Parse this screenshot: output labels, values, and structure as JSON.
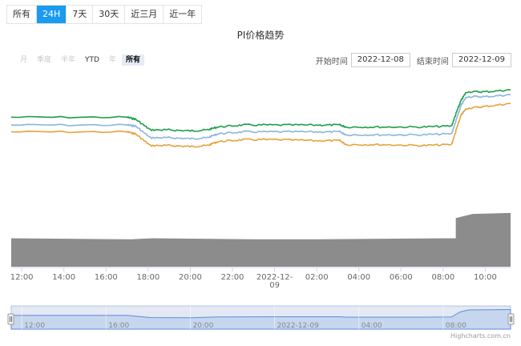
{
  "tabs": [
    {
      "label": "所有",
      "active": false
    },
    {
      "label": "24H",
      "active": true
    },
    {
      "label": "7天",
      "active": false
    },
    {
      "label": "30天",
      "active": false
    },
    {
      "label": "近三月",
      "active": false
    },
    {
      "label": "近一年",
      "active": false
    }
  ],
  "range_selector": {
    "buttons": [
      {
        "label": "月",
        "state": "disabled"
      },
      {
        "label": "季度",
        "state": "disabled"
      },
      {
        "label": "半年",
        "state": "disabled"
      },
      {
        "label": "YTD",
        "state": "enabled"
      },
      {
        "label": "年",
        "state": "disabled"
      },
      {
        "label": "所有",
        "state": "selected"
      }
    ],
    "start_label": "开始时间",
    "start_value": "2022-12-08",
    "end_label": "结束时间",
    "end_value": "2022-12-09"
  },
  "credit": "Highcharts.com.cn",
  "colors": {
    "green": "#1e9e4a",
    "blue": "#8ab6dd",
    "orange": "#e6a23c",
    "volume": "#8c8c8c",
    "navigator": "#ccd6eb"
  },
  "chart_data": {
    "type": "line",
    "title": "PI价格趋势",
    "x_tick_labels": [
      "12:00",
      "14:00",
      "16:00",
      "18:00",
      "20:00",
      "22:00",
      "2022-12-09",
      "02:00",
      "04:00",
      "06:00",
      "08:00",
      "10:00"
    ],
    "x_tick_hours": [
      12,
      14,
      16,
      18,
      20,
      22,
      24,
      26,
      28,
      30,
      32,
      34
    ],
    "x_range_hours": [
      11.5,
      35.2
    ],
    "y_range": [
      0,
      100
    ],
    "series": [
      {
        "color": "green",
        "x": [
          11.5,
          17.0,
          17.4,
          18.1,
          19.0,
          20.0,
          20.8,
          21.3,
          22.5,
          24.0,
          26.0,
          27.1,
          27.4,
          29.0,
          31.0,
          32.4,
          32.65,
          32.85,
          33.1,
          34.0,
          35.2
        ],
        "y": [
          62,
          62,
          60,
          49,
          49,
          48,
          49,
          52,
          54,
          54,
          54,
          54,
          52,
          52,
          52,
          53,
          68,
          79,
          88,
          88,
          90
        ]
      },
      {
        "color": "blue",
        "x": [
          11.5,
          17.0,
          17.4,
          18.1,
          19.0,
          20.0,
          20.8,
          21.3,
          22.5,
          24.0,
          26.0,
          27.1,
          27.4,
          29.0,
          31.0,
          32.4,
          32.65,
          32.85,
          33.1,
          34.0,
          35.2
        ],
        "y": [
          54,
          54,
          53,
          41,
          41,
          40,
          41,
          45,
          47,
          47,
          47,
          47,
          44,
          44,
          44,
          45,
          61,
          74,
          83,
          83,
          85
        ]
      },
      {
        "color": "orange",
        "x": [
          11.5,
          17.0,
          17.4,
          18.1,
          19.0,
          20.0,
          20.8,
          21.3,
          22.5,
          24.0,
          26.0,
          27.1,
          27.4,
          29.0,
          31.0,
          32.4,
          32.65,
          32.85,
          33.1,
          34.0,
          35.2
        ],
        "y": [
          47,
          47,
          45,
          33,
          33,
          32,
          33,
          37,
          39,
          39,
          38,
          38,
          34,
          34,
          33,
          34,
          51,
          64,
          71,
          73,
          76
        ]
      }
    ],
    "volume": {
      "x": [
        11.5,
        17.2,
        18.2,
        23.0,
        26.0,
        32.3,
        32.6,
        33.4,
        35.2
      ],
      "y": [
        28,
        27,
        28,
        27,
        27,
        28,
        48,
        52,
        53
      ],
      "y_range": [
        0,
        60
      ]
    },
    "navigator": {
      "x_tick_labels": [
        "12:00",
        "16:00",
        "20:00",
        "2022-12-09",
        "04:00",
        "08:00"
      ],
      "x_tick_hours": [
        12,
        16,
        20,
        24,
        28,
        32
      ],
      "x": [
        11.5,
        17.0,
        18.1,
        20.0,
        21.3,
        24.0,
        27.1,
        27.4,
        31.0,
        32.4,
        32.8,
        33.2,
        35.2
      ],
      "y": [
        61,
        61,
        50,
        49,
        53,
        54,
        54,
        52,
        52,
        53,
        78,
        88,
        90
      ]
    }
  }
}
